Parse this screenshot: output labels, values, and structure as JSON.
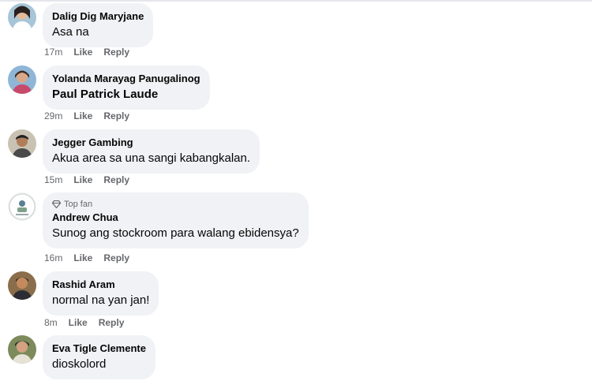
{
  "comments": [
    {
      "author": "Dalig Dig Maryjane",
      "text": "Asa na",
      "time": "17m",
      "like": "Like",
      "reply": "Reply"
    },
    {
      "author": "Yolanda Marayag Panugalinog",
      "text": "Paul Patrick Laude",
      "time": "29m",
      "like": "Like",
      "reply": "Reply"
    },
    {
      "author": "Jegger Gambing",
      "text": "Akua area sa una sangi kabangkalan.",
      "time": "15m",
      "like": "Like",
      "reply": "Reply"
    },
    {
      "author": "Andrew Chua",
      "badge": "Top fan",
      "text": "Sunog ang stockroom para walang ebidensya?",
      "time": "16m",
      "like": "Like",
      "reply": "Reply"
    },
    {
      "author": "Rashid Aram",
      "text": "normal na yan jan!",
      "time": "8m",
      "like": "Like",
      "reply": "Reply"
    },
    {
      "author": "Eva Tigle Clemente",
      "text": "dioskolord"
    }
  ],
  "icons": {
    "badge_icon": "diamond-icon"
  },
  "colors": {
    "bubble_bg": "#f0f2f5",
    "secondary_text": "#65676b",
    "primary_text": "#050505"
  }
}
